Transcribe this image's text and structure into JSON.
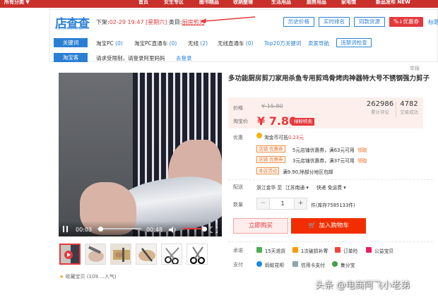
{
  "top_nav": [
    "所有分类 ▼",
    "首页",
    "女生专区",
    "图书精品",
    "收纳整理",
    "生活用品",
    "厨房用品",
    "家电馆",
    "新品发布 NEW"
  ],
  "plugin": {
    "logo_text": "店查查",
    "logo_sub": "DIANCHACHA.COM",
    "shelf_label": "下架:",
    "shelf_date": "02-29 19:47",
    "shelf_day": "[星期六]",
    "category_label": "类目:",
    "category_value": "厨房剪刀",
    "top_buttons": [
      "历史价格",
      "实时排名",
      "同款货源"
    ],
    "coupon_button": "%↓优惠券",
    "label_link": "标题",
    "keywords_tag": "关键词",
    "keywords": [
      {
        "label": "淘宝PC",
        "count": "(0)"
      },
      {
        "label": "淘宝PC直通车",
        "count": "(0)"
      },
      {
        "label": "无线",
        "count": "(2)"
      },
      {
        "label": "无线直通车",
        "count": "(0)"
      },
      {
        "label": "Top20万关键词",
        "count": ""
      },
      {
        "label": "卖家导航",
        "count": ""
      }
    ],
    "seo_button": "违禁词检查",
    "taobaoke_tag": "淘宝客",
    "taobaoke_notice": "请求受限制，请登录阿里妈妈",
    "taobaoke_link": "去登录"
  },
  "report": "举报",
  "video": {
    "current_time": "00:03",
    "duration": "00:48",
    "progress": 0.06,
    "volume": 0.8
  },
  "thumbnails_count": 6,
  "favorite": "收藏宝贝 (109....人气)",
  "product": {
    "title": "多功能厨房剪刀家用杀鱼专用剪鸡骨烤肉神器特大号不锈钢强力剪子",
    "price_label": "价格",
    "original_price": "¥ 15.80",
    "promo_label": "淘宝价",
    "promo_price": "¥ 7.80",
    "promo_badge": "绿粉特卖",
    "reviews_count": "262986",
    "reviews_label": "累计评论",
    "sales_count": "4782",
    "sales_label": "交易成功",
    "offers_label": "优惠",
    "coin_text": "淘金币可抵",
    "coin_amount": "0.23元",
    "offers": [
      {
        "tag": "店铺 优惠券",
        "text": "5元店铺优惠券，满63元可用",
        "link": "领取"
      },
      {
        "tag": "店铺 优惠券",
        "text": "3元店铺优惠券，满37元可用",
        "link": "领取"
      },
      {
        "tag": "本店活动",
        "text": "满9.90,除部分地区包邮",
        "link": ""
      }
    ],
    "ship_label": "配送",
    "ship_from": "浙江金华 至",
    "ship_to": "江苏南通 ▾",
    "ship_method": "快递 免运费 ▾",
    "qty_label": "数量",
    "qty_value": "1",
    "stock": "件(库存7585133件)",
    "buy_now": "立即购买",
    "add_cart": "加入购物车",
    "promise_label": "承诺",
    "promises": [
      "15天退货",
      "1次破损补寄",
      "订单险",
      "公益宝贝"
    ],
    "pay_label": "支付",
    "payments": [
      "蚂蚁花呗",
      "信用卡支付",
      "集分宝"
    ]
  },
  "watermark": "头条 @电商阿飞小老弟",
  "colors": {
    "accent": "#2a7fd4",
    "price": "#e4393c",
    "cart": "#f22e00",
    "nav": "#c9302c"
  }
}
